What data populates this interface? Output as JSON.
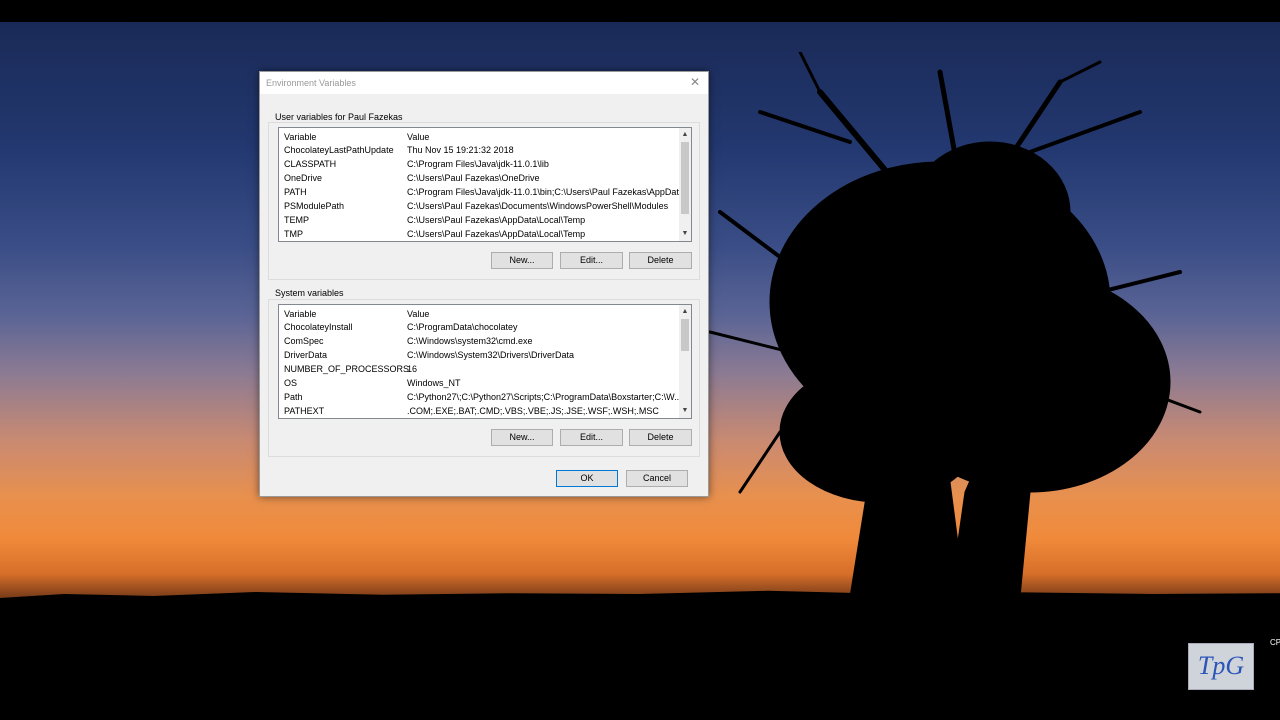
{
  "dialog": {
    "title": "Environment Variables",
    "close_glyph": "✕",
    "user_section": {
      "label": "User variables for Paul Fazekas",
      "columns": [
        "Variable",
        "Value"
      ],
      "rows": [
        {
          "variable": "ChocolateyLastPathUpdate",
          "value": "Thu Nov 15 19:21:32 2018"
        },
        {
          "variable": "CLASSPATH",
          "value": "C:\\Program Files\\Java\\jdk-11.0.1\\lib"
        },
        {
          "variable": "OneDrive",
          "value": "C:\\Users\\Paul Fazekas\\OneDrive"
        },
        {
          "variable": "PATH",
          "value": "C:\\Program Files\\Java\\jdk-11.0.1\\bin;C:\\Users\\Paul Fazekas\\AppDat..."
        },
        {
          "variable": "PSModulePath",
          "value": "C:\\Users\\Paul Fazekas\\Documents\\WindowsPowerShell\\Modules"
        },
        {
          "variable": "TEMP",
          "value": "C:\\Users\\Paul Fazekas\\AppData\\Local\\Temp"
        },
        {
          "variable": "TMP",
          "value": "C:\\Users\\Paul Fazekas\\AppData\\Local\\Temp"
        }
      ],
      "buttons": {
        "new": "New...",
        "edit": "Edit...",
        "delete": "Delete"
      }
    },
    "system_section": {
      "label": "System variables",
      "columns": [
        "Variable",
        "Value"
      ],
      "rows": [
        {
          "variable": "ChocolateyInstall",
          "value": "C:\\ProgramData\\chocolatey"
        },
        {
          "variable": "ComSpec",
          "value": "C:\\Windows\\system32\\cmd.exe"
        },
        {
          "variable": "DriverData",
          "value": "C:\\Windows\\System32\\Drivers\\DriverData"
        },
        {
          "variable": "NUMBER_OF_PROCESSORS",
          "value": "16"
        },
        {
          "variable": "OS",
          "value": "Windows_NT"
        },
        {
          "variable": "Path",
          "value": "C:\\Python27\\;C:\\Python27\\Scripts;C:\\ProgramData\\Boxstarter;C:\\W..."
        },
        {
          "variable": "PATHEXT",
          "value": ".COM;.EXE;.BAT;.CMD;.VBS;.VBE;.JS;.JSE;.WSF;.WSH;.MSC"
        }
      ],
      "buttons": {
        "new": "New...",
        "edit": "Edit...",
        "delete": "Delete"
      }
    },
    "ok_label": "OK",
    "cancel_label": "Cancel"
  },
  "scroll_arrows": {
    "up": "▲",
    "down": "▼"
  },
  "logo": {
    "text": "TpG",
    "color": "#2a55b8"
  },
  "edge_text": "CP"
}
